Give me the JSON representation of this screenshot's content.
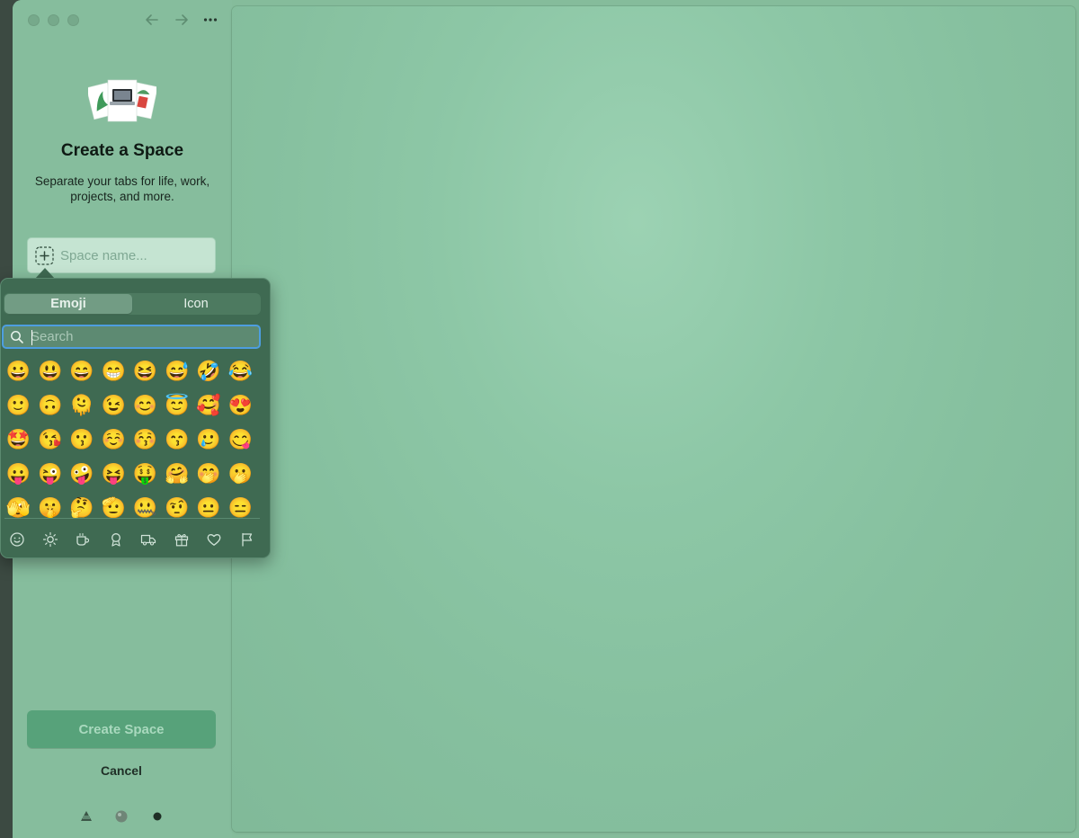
{
  "window": {
    "nav": {
      "back_icon": "arrow-left-icon",
      "forward_icon": "arrow-right-icon",
      "more_icon": "ellipsis-icon"
    }
  },
  "create_space": {
    "title": "Create a Space",
    "subtitle": "Separate your tabs for life, work, projects, and more.",
    "name_placeholder": "Space name...",
    "create_button_label": "Create Space",
    "cancel_label": "Cancel"
  },
  "emoji_picker": {
    "tabs": [
      {
        "label": "Emoji",
        "active": true
      },
      {
        "label": "Icon",
        "active": false
      }
    ],
    "search_placeholder": "Search",
    "rows": [
      [
        "😀",
        "😃",
        "😄",
        "😁",
        "😆",
        "😅",
        "🤣",
        "😂"
      ],
      [
        "🙂",
        "🙃",
        "🫠",
        "😉",
        "😊",
        "😇",
        "🥰",
        "😍"
      ],
      [
        "🤩",
        "😘",
        "😗",
        "☺️",
        "😚",
        "😙",
        "🥲",
        "😋"
      ],
      [
        "😛",
        "😜",
        "🤪",
        "😝",
        "🤑",
        "🤗",
        "🤭",
        "🫢"
      ],
      [
        "🫣",
        "🤫",
        "🤔",
        "🫡",
        "🤐",
        "🤨",
        "😐",
        "😑"
      ]
    ],
    "categories": [
      "smiley-icon",
      "sun-icon",
      "coffee-cup-icon",
      "award-ribbon-icon",
      "truck-icon",
      "gift-icon",
      "heart-icon",
      "flag-icon"
    ]
  },
  "colors": {
    "accent_focus": "#4d9ee0",
    "create_button": "#57a27a",
    "window_bg": "#85bc9b"
  }
}
